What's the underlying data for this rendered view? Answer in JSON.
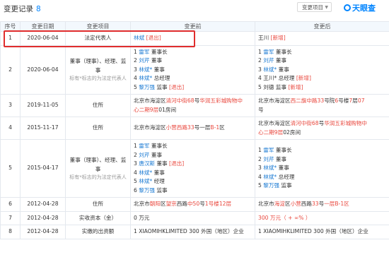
{
  "header": {
    "title": "变更记录",
    "count": "8",
    "select_label": "变更项目",
    "logo_text": "天眼查"
  },
  "columns": [
    "序号",
    "变更日期",
    "变更项目",
    "变更前",
    "变更后"
  ],
  "rows": [
    {
      "index": "1",
      "date": "2020-06-04",
      "item": "法定代表人",
      "before": [
        [
          "林斌",
          "blue"
        ],
        [
          "[退出]",
          "red"
        ]
      ],
      "after": [
        [
          "王川",
          "plain"
        ],
        [
          "[新增]",
          "red"
        ]
      ]
    },
    {
      "index": "2",
      "date": "2020-06-04",
      "item": "董事（理事）、经理、监事",
      "item_note": "标有*标志的为法定代表人",
      "before_lines": [
        [
          [
            "1 ",
            "plain"
          ],
          [
            "雷军",
            "blue"
          ],
          [
            " 董事长",
            "plain"
          ]
        ],
        [
          [
            "2 ",
            "plain"
          ],
          [
            "刘芹",
            "blue"
          ],
          [
            " 董事",
            "plain"
          ]
        ],
        [
          [
            "3 ",
            "plain"
          ],
          [
            "林斌*",
            "blue"
          ],
          [
            " 董事",
            "plain"
          ]
        ],
        [
          [
            "4 ",
            "plain"
          ],
          [
            "林斌*",
            "blue"
          ],
          [
            " 总经理",
            "plain"
          ]
        ],
        [
          [
            "5 ",
            "plain"
          ],
          [
            "黎万强",
            "blue"
          ],
          [
            " 监事 ",
            "plain"
          ],
          [
            "[退出]",
            "red"
          ]
        ]
      ],
      "after_lines": [
        [
          [
            "1 ",
            "plain"
          ],
          [
            "雷军",
            "blue"
          ],
          [
            " 董事长",
            "plain"
          ]
        ],
        [
          [
            "2 ",
            "plain"
          ],
          [
            "刘芹",
            "blue"
          ],
          [
            " 董事",
            "plain"
          ]
        ],
        [
          [
            "3 ",
            "plain"
          ],
          [
            "林斌*",
            "blue"
          ],
          [
            " 董事",
            "plain"
          ]
        ],
        [
          [
            "4 ",
            "plain"
          ],
          [
            "王川*",
            "plain"
          ],
          [
            " 总经理 ",
            "plain"
          ],
          [
            "[新增]",
            "red"
          ]
        ],
        [
          [
            "5 ",
            "plain"
          ],
          [
            "刘德",
            "plain"
          ],
          [
            " 监事 ",
            "plain"
          ],
          [
            "[新增]",
            "red"
          ]
        ]
      ]
    },
    {
      "index": "3",
      "date": "2019-11-05",
      "item": "住所",
      "before_lines": [
        [
          [
            "北京市海淀区",
            "plain"
          ],
          [
            "清河中街68",
            "red"
          ],
          [
            "号",
            "plain"
          ],
          [
            "华润五彩城购物中",
            "red"
          ]
        ],
        [
          [
            "心二期9层",
            "red"
          ],
          [
            "01",
            "plain"
          ],
          [
            "房间",
            "plain"
          ]
        ]
      ],
      "after_lines": [
        [
          [
            "北京市海淀区",
            "plain"
          ],
          [
            "西二旗中路33",
            "red"
          ],
          [
            "号院",
            "plain"
          ],
          [
            "6",
            "red"
          ],
          [
            "号楼",
            "plain"
          ],
          [
            "7",
            "red"
          ],
          [
            "层",
            "plain"
          ],
          [
            "07",
            "red"
          ]
        ],
        [
          [
            "号",
            "plain"
          ]
        ]
      ]
    },
    {
      "index": "4",
      "date": "2015-11-17",
      "item": "住所",
      "before_lines": [
        [
          [
            "北京市海淀区",
            "plain"
          ],
          [
            "小营西路33",
            "red"
          ],
          [
            "号一层",
            "plain"
          ],
          [
            "B-1",
            "red"
          ],
          [
            "区",
            "plain"
          ]
        ]
      ],
      "after_lines": [
        [
          [
            "北京市海淀区",
            "plain"
          ],
          [
            "清河中街68",
            "red"
          ],
          [
            "号",
            "plain"
          ],
          [
            "华润五彩城购物中",
            "red"
          ]
        ],
        [
          [
            "心二期9层",
            "red"
          ],
          [
            "02",
            "plain"
          ],
          [
            "房间",
            "plain"
          ]
        ]
      ]
    },
    {
      "index": "5",
      "date": "2015-04-17",
      "item": "董事（理事）、经理、监事",
      "item_note": "标有*标志的为法定代表人",
      "before_lines": [
        [
          [
            "1 ",
            "plain"
          ],
          [
            "雷军",
            "blue"
          ],
          [
            " 董事长",
            "plain"
          ]
        ],
        [
          [
            "2 ",
            "plain"
          ],
          [
            "刘芹",
            "blue"
          ],
          [
            " 董事",
            "plain"
          ]
        ],
        [
          [
            "3 ",
            "plain"
          ],
          [
            "唐汉斯",
            "blue"
          ],
          [
            " 董事 ",
            "plain"
          ],
          [
            "[退出]",
            "red"
          ]
        ],
        [
          [
            "4 ",
            "plain"
          ],
          [
            "林斌*",
            "blue"
          ],
          [
            " 董事",
            "plain"
          ]
        ],
        [
          [
            "5 ",
            "plain"
          ],
          [
            "林斌*",
            "blue"
          ],
          [
            " 经理",
            "plain"
          ]
        ],
        [
          [
            "6 ",
            "plain"
          ],
          [
            "黎万强",
            "blue"
          ],
          [
            " 监事",
            "plain"
          ]
        ]
      ],
      "after_lines": [
        [
          [
            "1 ",
            "plain"
          ],
          [
            "雷军",
            "blue"
          ],
          [
            " 董事长",
            "plain"
          ]
        ],
        [
          [
            "2 ",
            "plain"
          ],
          [
            "刘芹",
            "blue"
          ],
          [
            " 董事",
            "plain"
          ]
        ],
        [
          [
            "3 ",
            "plain"
          ],
          [
            "林斌*",
            "blue"
          ],
          [
            " 董事",
            "plain"
          ]
        ],
        [
          [
            "4 ",
            "plain"
          ],
          [
            "林斌*",
            "blue"
          ],
          [
            " 总经理",
            "plain"
          ]
        ],
        [
          [
            "5 ",
            "plain"
          ],
          [
            "黎万强",
            "blue"
          ],
          [
            " 监事",
            "plain"
          ]
        ]
      ]
    },
    {
      "index": "6",
      "date": "2012-04-28",
      "item": "住所",
      "before_lines": [
        [
          [
            "北京市",
            "plain"
          ],
          [
            "朝阳",
            "red"
          ],
          [
            "区",
            "plain"
          ],
          [
            "望京",
            "red"
          ],
          [
            "西路",
            "plain"
          ],
          [
            "中",
            "red"
          ],
          [
            "50",
            "red"
          ],
          [
            "号",
            "plain"
          ],
          [
            "1号楼12层",
            "red"
          ]
        ]
      ],
      "after_lines": [
        [
          [
            "北京市",
            "plain"
          ],
          [
            "海淀",
            "red"
          ],
          [
            "区",
            "plain"
          ],
          [
            "小营",
            "red"
          ],
          [
            "西路",
            "plain"
          ],
          [
            "33",
            "red"
          ],
          [
            "号",
            "plain"
          ],
          [
            "一层B-1区",
            "red"
          ]
        ]
      ]
    },
    {
      "index": "7",
      "date": "2012-04-28",
      "item": "实收资本（金）",
      "before_lines": [
        [
          [
            "0 万元",
            "plain"
          ]
        ]
      ],
      "after_lines": [
        [
          [
            "300 万元（ + ∞% ）",
            "red"
          ]
        ]
      ]
    },
    {
      "index": "8",
      "date": "2012-04-28",
      "item": "实缴的出资额",
      "before_lines": [
        [
          [
            "1 XIAOMIHKLIMITED 300 外国（地区）企业",
            "plain"
          ]
        ]
      ],
      "after_lines": [
        [
          [
            "1 XIAOMIHKLIMITED 300 外国（地区）企业",
            "plain"
          ]
        ]
      ]
    }
  ],
  "colors": {
    "accent": "#0084ff",
    "link": "#1a7ad3",
    "change": "#e9473d",
    "highlight_box": "#e02d2d"
  }
}
